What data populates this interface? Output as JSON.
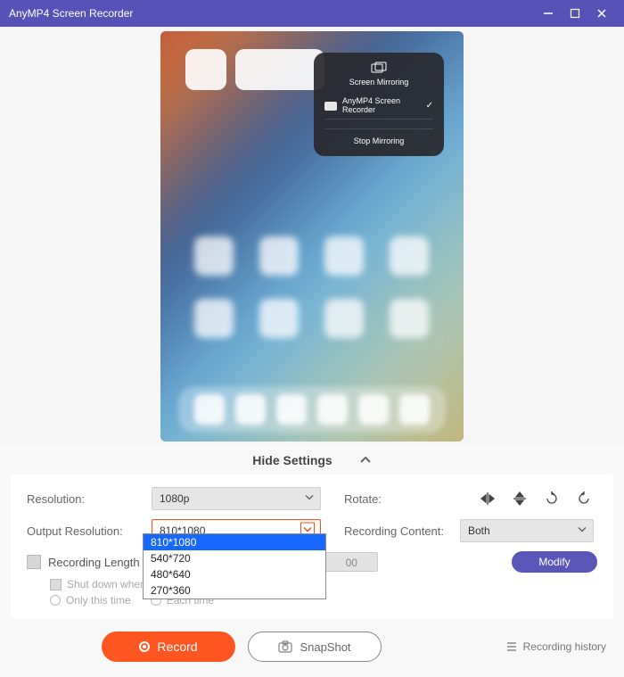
{
  "titlebar": {
    "title": "AnyMP4 Screen Recorder"
  },
  "mirror_popup": {
    "header": "Screen Mirroring",
    "item_label": "AnyMP4 Screen Recorder",
    "stop": "Stop Mirroring"
  },
  "hide_settings": "Hide Settings",
  "settings": {
    "resolution_label": "Resolution:",
    "resolution_value": "1080p",
    "output_res_label": "Output Resolution:",
    "output_res_value": "810*1080",
    "output_res_options": [
      "810*1080",
      "540*720",
      "480*640",
      "270*360"
    ],
    "rotate_label": "Rotate:",
    "recording_content_label": "Recording Content:",
    "recording_content_value": "Both",
    "recording_length_label": "Recording Length",
    "time_mm": "00",
    "modify": "Modify",
    "shutdown_label": "Shut down when recording ends",
    "only_this_time": "Only this time",
    "each_time": "Each time"
  },
  "buttons": {
    "record": "Record",
    "snapshot": "SnapShot",
    "history": "Recording history"
  }
}
